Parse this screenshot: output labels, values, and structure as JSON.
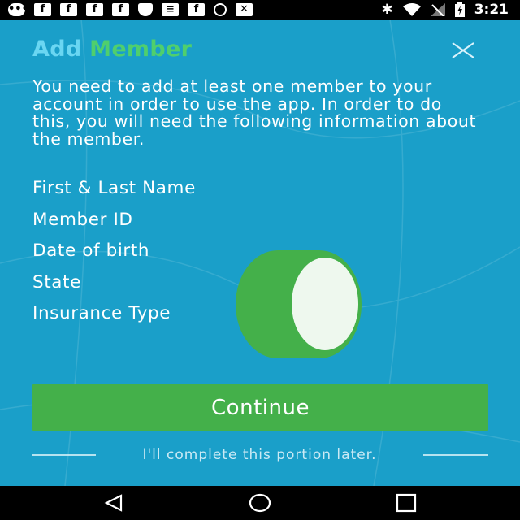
{
  "status_bar": {
    "time": "3:21",
    "icons": [
      "message-icon",
      "facebook-icon",
      "facebook-icon",
      "facebook-icon",
      "facebook-icon",
      "shield-icon",
      "voicemail-icon",
      "facebook-icon",
      "ring-icon",
      "tools-icon",
      "bluetooth-icon",
      "wifi-icon",
      "no-signal-icon",
      "battery-charging-icon"
    ]
  },
  "header": {
    "title_part1": "Add",
    "title_part2": "Member",
    "close_icon": "close-icon"
  },
  "intro_text": "You need to add at least one member to your account in order to use the app. In order to do this, you will need the following information about the member.",
  "required_info": [
    "First & Last Name",
    "Member ID",
    "Date of birth",
    "State",
    "Insurance Type"
  ],
  "continue_label": "Continue",
  "later_label": "I'll complete this portion later.",
  "nav": {
    "back_icon": "back-triangle-icon",
    "home_icon": "home-circle-icon",
    "recents_icon": "recents-square-icon"
  },
  "colors": {
    "background": "#1a9fc9",
    "title_add": "#6ad6f2",
    "title_member": "#4fcf6d",
    "button": "#44b04a"
  }
}
